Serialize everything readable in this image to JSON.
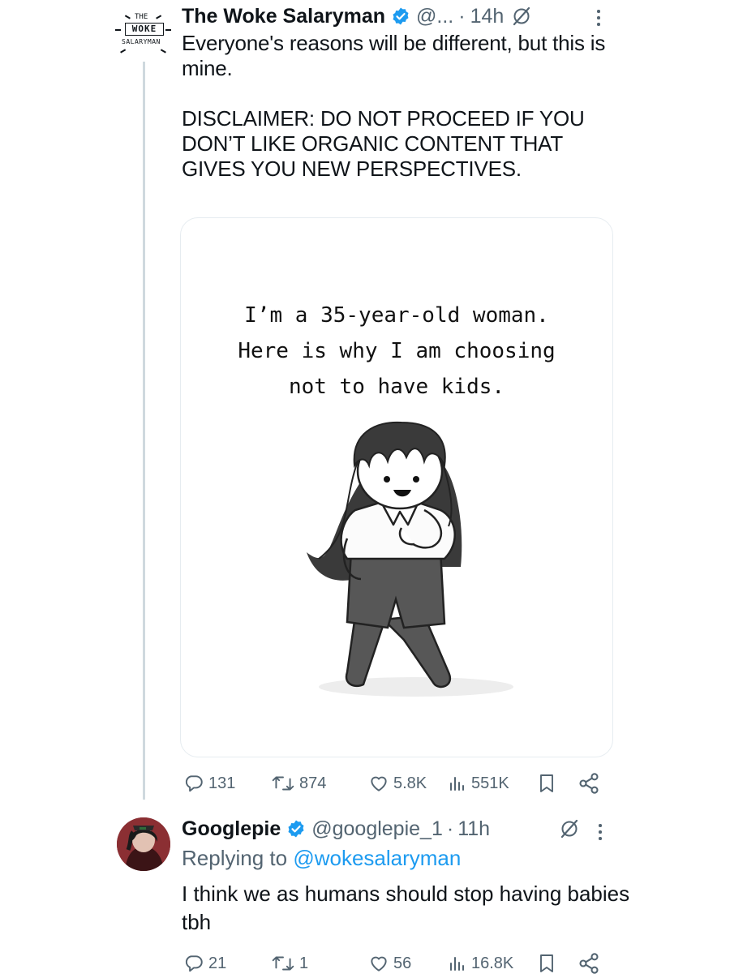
{
  "tweet1": {
    "author_name": "The Woke Salaryman",
    "handle": "@...",
    "dot": "·",
    "time": "14h",
    "avatar_logo": {
      "line1": "THE",
      "line2": "WOKE",
      "line3": "SALARYMAN"
    },
    "text_lines": [
      "Everyone's reasons will be different, but this is mine."
    ],
    "disclaimer": "DISCLAIMER: DO NOT PROCEED IF YOU DON’T LIKE ORGANIC CONTENT THAT GIVES YOU NEW PERSPECTIVES.",
    "media": {
      "title_lines": [
        "I’m a 35-year-old woman.",
        "Here is why I am choosing",
        "not to have kids."
      ]
    },
    "actions": {
      "replies": "131",
      "reposts": "874",
      "likes": "5.8K",
      "views": "551K"
    }
  },
  "tweet2": {
    "author_name": "Googlepie",
    "handle": "@googlepie_1",
    "dot": "·",
    "time": "11h",
    "replying_prefix": "Replying to ",
    "replying_to": "@wokesalaryman",
    "text": "I think we as humans should stop having babies tbh",
    "actions": {
      "replies": "21",
      "reposts": "1",
      "likes": "56",
      "views": "16.8K"
    }
  },
  "colors": {
    "text": "#0f1419",
    "muted": "#536471",
    "accent": "#1d9bf0",
    "thread_line": "#cfd9de",
    "card_border": "#e6ecf0"
  },
  "icons": {
    "verified": "verified-badge-icon",
    "grok": "grok-icon",
    "more": "more-dots-icon",
    "reply": "reply-icon",
    "repost": "repost-icon",
    "like": "like-icon",
    "views": "views-icon",
    "bookmark": "bookmark-icon",
    "share": "share-icon"
  }
}
